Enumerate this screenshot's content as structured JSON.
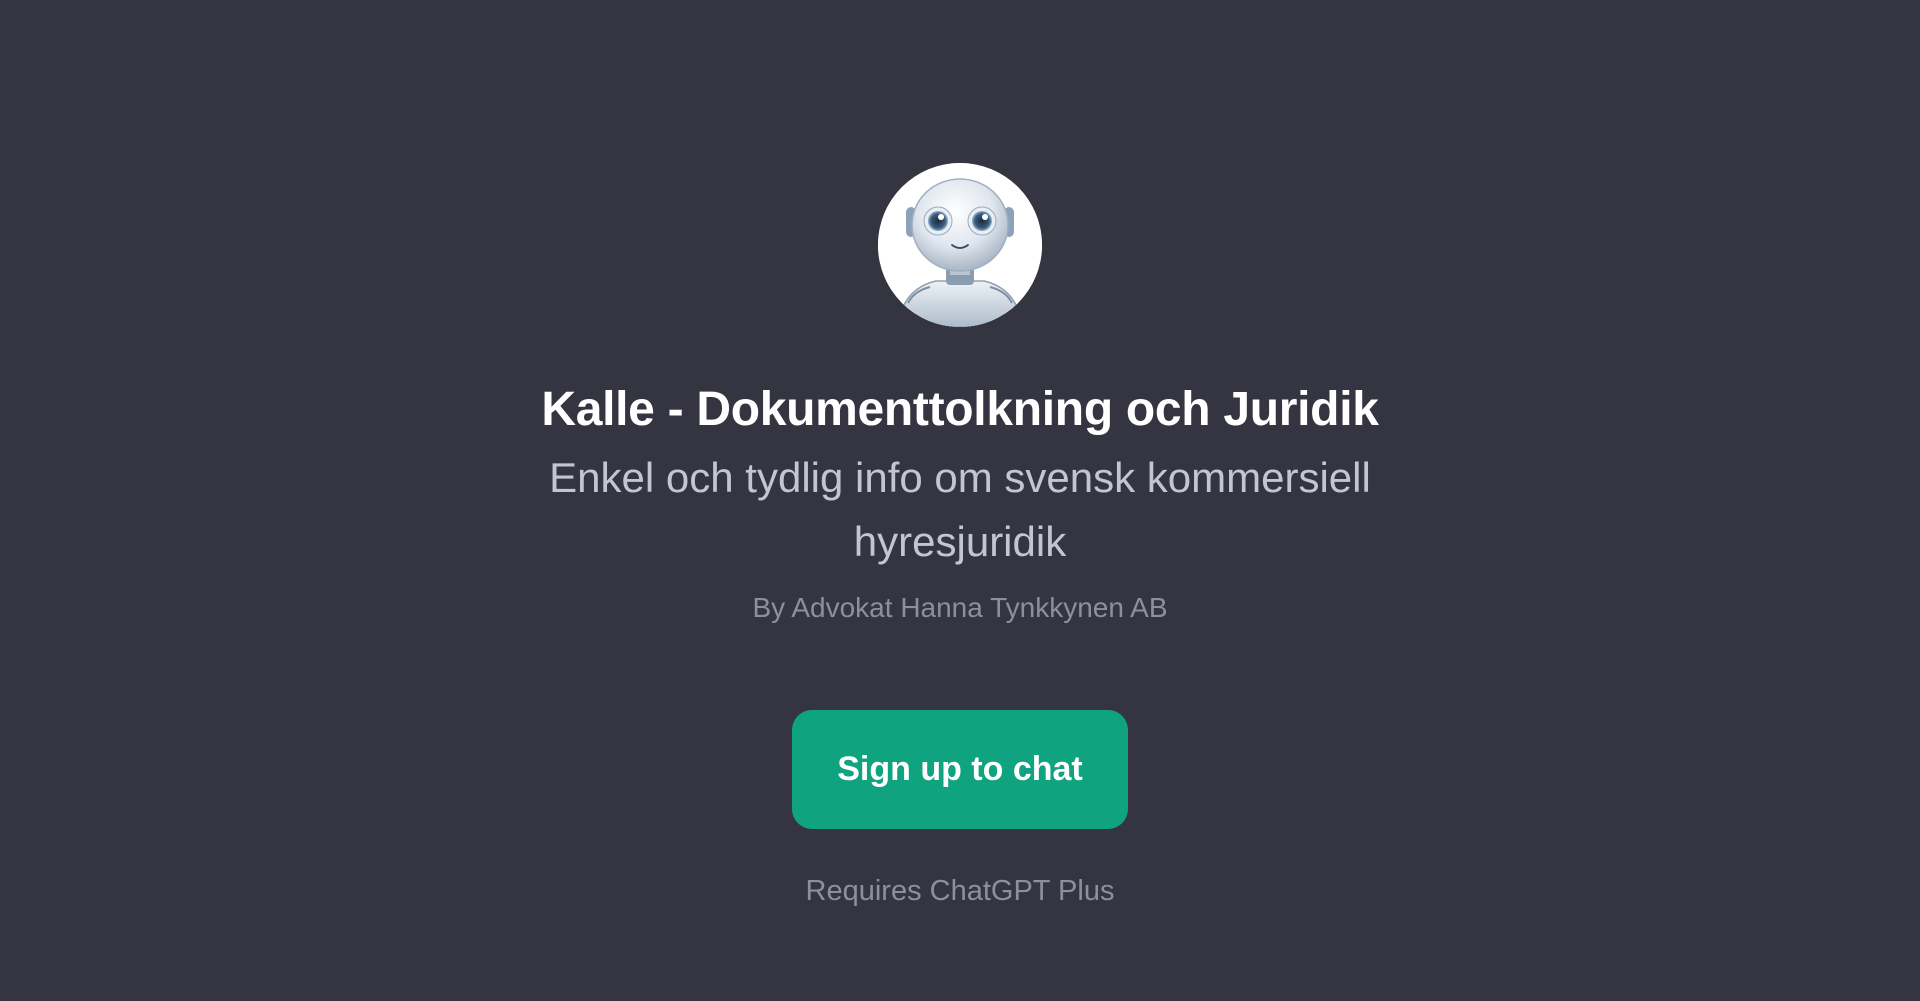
{
  "gpt": {
    "avatar_icon": "robot-avatar-icon",
    "title": "Kalle - Dokumenttolkning och Juridik",
    "description": "Enkel och tydlig info om svensk kommersiell hyresjuridik",
    "author": "By Advokat Hanna Tynkkynen AB"
  },
  "actions": {
    "signup_label": "Sign up to chat",
    "requirement_note": "Requires ChatGPT Plus"
  },
  "colors": {
    "background": "#343541",
    "accent": "#10a37f",
    "title": "#ffffff",
    "subtitle": "#c5c5d2",
    "muted": "#8e8ea0"
  }
}
